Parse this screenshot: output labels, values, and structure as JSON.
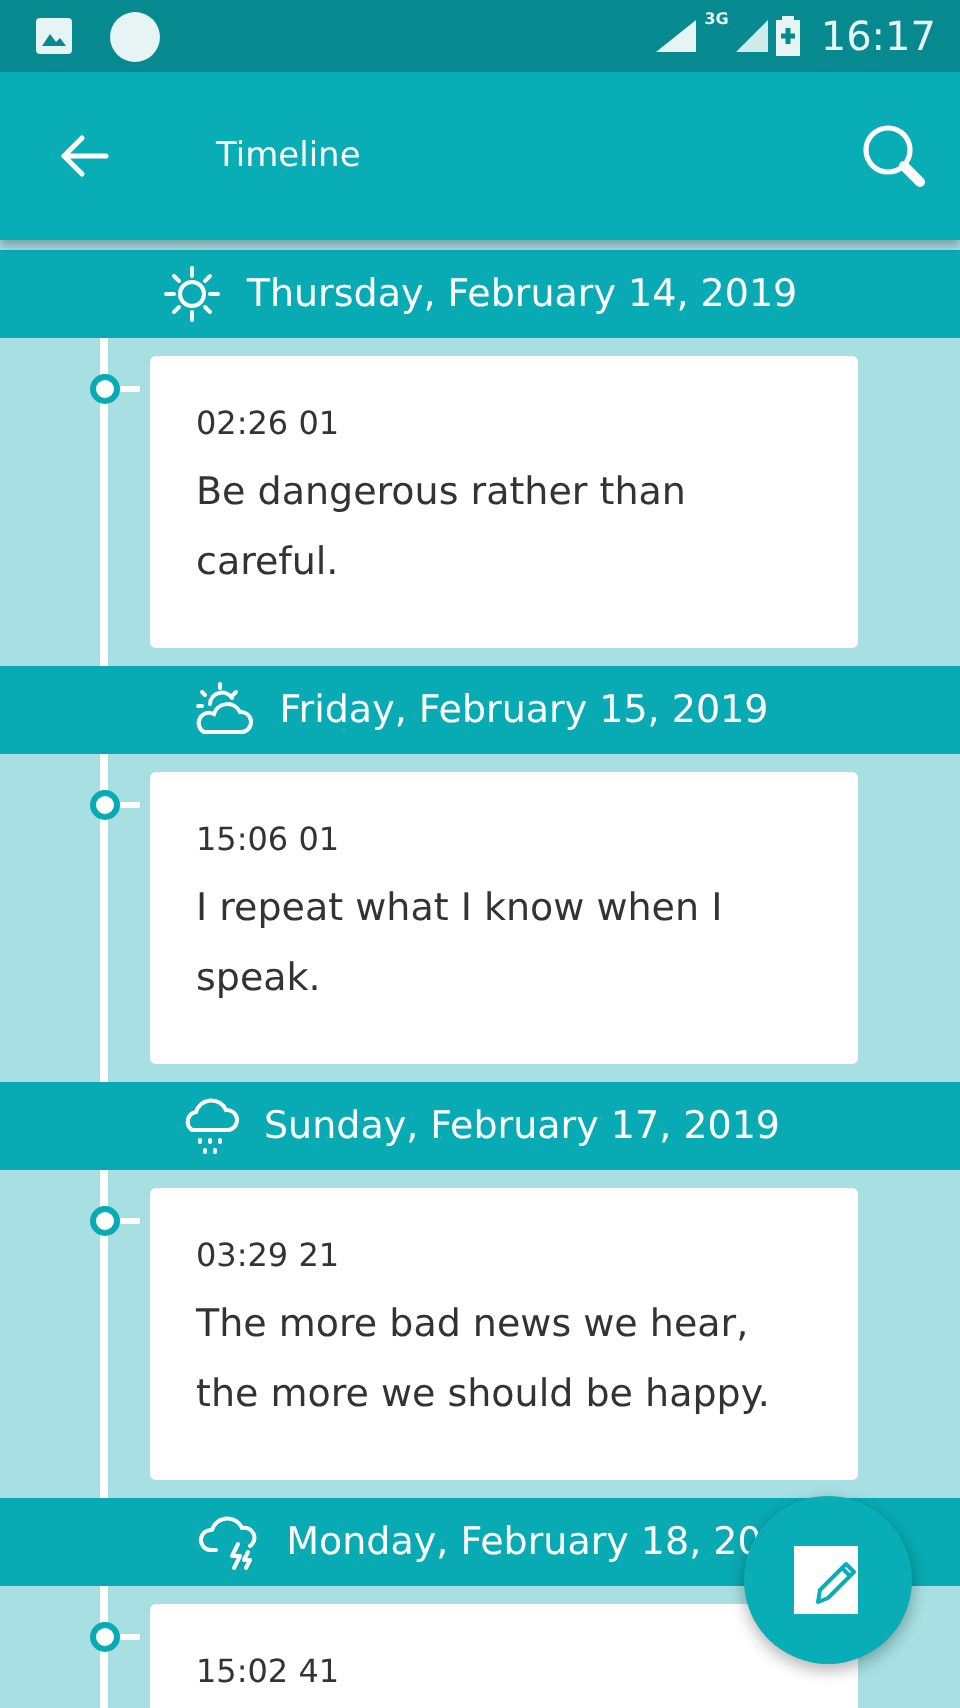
{
  "status_bar": {
    "network": "3G",
    "time": "16:17"
  },
  "app_bar": {
    "title": "Timeline"
  },
  "days": [
    {
      "kind": "sunny",
      "date": "Thursday, February 14, 2019",
      "entries": [
        {
          "time": "02:26 01",
          "text": "Be dangerous rather than careful."
        }
      ]
    },
    {
      "kind": "partly-cloudy",
      "date": "Friday, February 15, 2019",
      "entries": [
        {
          "time": "15:06 01",
          "text": "I repeat what I know when I speak."
        }
      ]
    },
    {
      "kind": "rain",
      "date": "Sunday, February 17, 2019",
      "entries": [
        {
          "time": "03:29 21",
          "text": "The more bad news we hear, the more we should be happy."
        }
      ]
    },
    {
      "kind": "thunderstorm",
      "date": "Monday, February 18, 20",
      "entries": [
        {
          "time": "15:02 41"
        }
      ]
    }
  ]
}
